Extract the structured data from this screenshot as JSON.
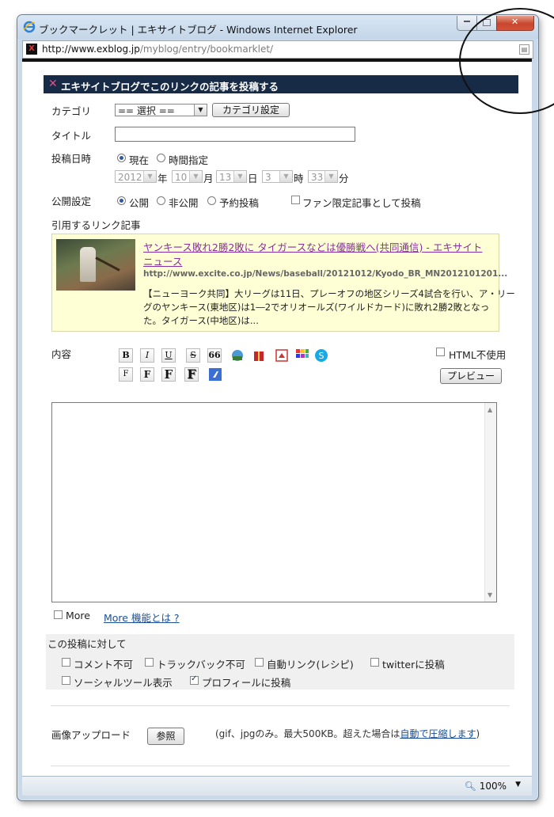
{
  "window": {
    "title": "ブックマークレット | エキサイトブログ - Windows Internet Explorer",
    "address_domain": "http://www.exblog.jp",
    "address_path": "/myblog/entry/bookmarklet/",
    "zoom": "100%"
  },
  "header": {
    "title": "エキサイトブログでこのリンクの記事を投稿する"
  },
  "category": {
    "label": "カテゴリ",
    "selected": "== 選択 ==",
    "settings_button": "カテゴリ設定"
  },
  "title_field": {
    "label": "タイトル",
    "value": ""
  },
  "post_date": {
    "label": "投稿日時",
    "now": "現在",
    "specify": "時間指定",
    "year": "2012",
    "year_unit": "年",
    "month": "10",
    "month_unit": "月",
    "day": "13",
    "day_unit": "日",
    "hour": "3",
    "hour_unit": "時",
    "minute": "33",
    "minute_unit": "分"
  },
  "visibility": {
    "label": "公開設定",
    "public": "公開",
    "private": "非公開",
    "scheduled": "予約投稿",
    "fan_only": "ファン限定記事として投稿"
  },
  "quote": {
    "label": "引用するリンク記事",
    "link_line1": "ヤンキース敗れ2勝2敗に タイガースなどは優勝戦へ(共同通信) - エキサイト",
    "link_line2": "ニュース",
    "url": "http://www.excite.co.jp/News/baseball/20121012/Kyodo_BR_MN2012101201...",
    "text_line1": "【ニューヨーク共同】大リーグは11日、プレーオフの地区シリーズ4試合を行い、ア・リー",
    "text_line2": "グのヤンキース(東地区)は1―2でオリオールズ(ワイルドカード)に敗れ2勝2敗となっ",
    "text_line3": "た。タイガース(中地区)は..."
  },
  "content": {
    "label": "内容",
    "toolbar_row1": [
      "B",
      "I",
      "U",
      "S",
      "66"
    ],
    "toolbar_row2": [
      "F",
      "F",
      "F",
      "F"
    ],
    "html_off": "HTML不使用",
    "preview_button": "プレビュー",
    "body": ""
  },
  "more": {
    "label": "More",
    "link": "More 機能とは ?"
  },
  "post_options": {
    "title": "この投稿に対して",
    "no_comment": "コメント不可",
    "no_trackback": "トラックバック不可",
    "auto_link": "自動リンク(レシピ)",
    "twitter": "twitterに投稿",
    "social": "ソーシャルツール表示",
    "profile": "プロフィールに投稿"
  },
  "upload": {
    "label": "画像アップロード",
    "button": "参照",
    "note_prefix": "(gif、jpgのみ。最大500KB。超えた場合は",
    "note_link": "自動で圧縮します",
    "note_suffix": ")"
  },
  "colors": {
    "header_bg": "#172b46",
    "accent_pink": "#e84a86",
    "link": "#1a4f9a",
    "quote_bg": "#ffffd6"
  }
}
